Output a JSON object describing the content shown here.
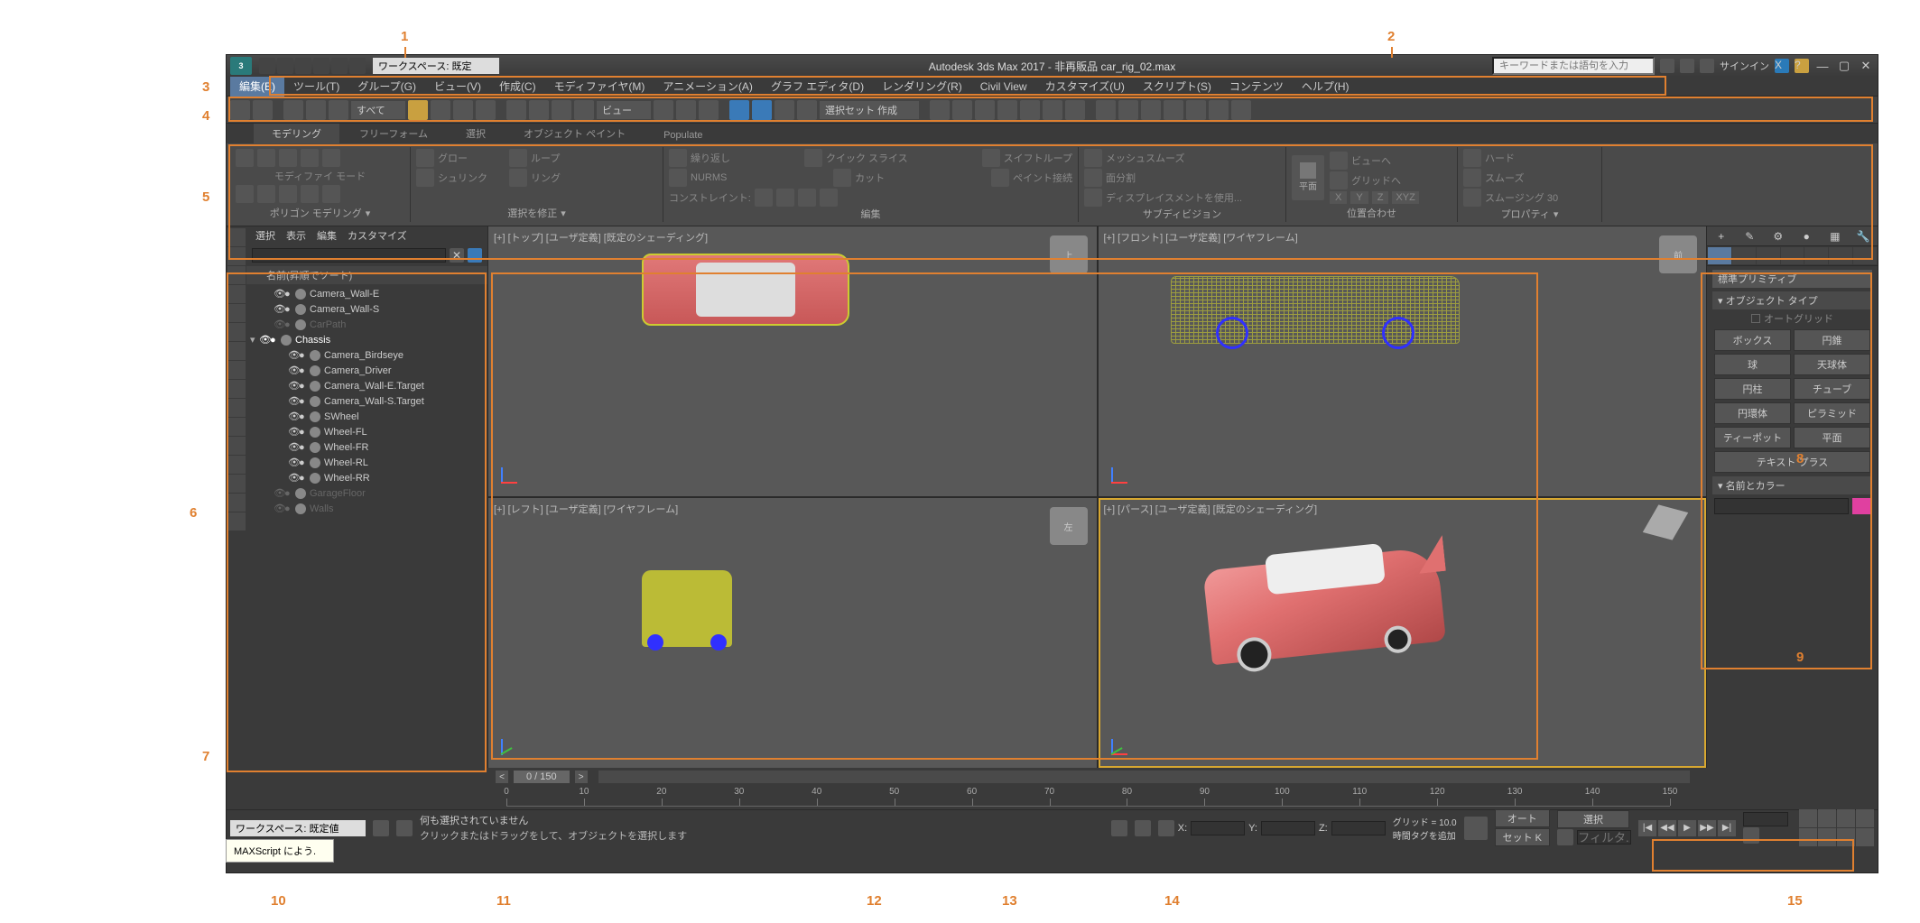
{
  "title": "Autodesk 3ds Max 2017  - 非再販品    car_rig_02.max",
  "workspace_combo": "ワークスペース: 既定",
  "search_placeholder": "キーワードまたは語句を入力",
  "signin": "サインイン",
  "menubar": [
    "編集(E)",
    "ツール(T)",
    "グループ(G)",
    "ビュー(V)",
    "作成(C)",
    "モディファイヤ(M)",
    "アニメーション(A)",
    "グラフ エディタ(D)",
    "レンダリング(R)",
    "Civil View",
    "カスタマイズ(U)",
    "スクリプト(S)",
    "コンテンツ",
    "ヘルプ(H)"
  ],
  "main_toolbar": {
    "dropdown1": "すべて",
    "dropdown_view": "ビュー",
    "sel_set": "選択セット 作成"
  },
  "ribbon_tabs": [
    "モデリング",
    "フリーフォーム",
    "選択",
    "オブジェクト ペイント",
    "Populate"
  ],
  "ribbon": {
    "mode_label": "モディファイ モード",
    "grow": "グロー",
    "shrink": "シュリンク",
    "loop": "ループ",
    "ring": "リング",
    "repeat": "繰り返し",
    "nurms": "NURMS",
    "quickslice": "クイック スライス",
    "cut": "カット",
    "swiftloop": "スイフトループ",
    "paintconnect": "ペイント接続",
    "constraint": "コンストレイント:",
    "meshsmooth": "メッシュスムーズ",
    "tessellate": "面分割",
    "disp": "ディスプレイスメントを使用...",
    "plane_label": "平面",
    "viewto": "ビューへ",
    "gridto": "グリッドへ",
    "hard": "ハード",
    "smooth": "スムーズ",
    "smoothing30": "スムージング 30",
    "xyz": "XYZ",
    "x": "X",
    "y": "Y",
    "z": "Z",
    "group_polymodel": "ポリゴン モデリング",
    "group_modsel": "選択を修正",
    "group_edit": "編集",
    "group_subdiv": "サブディビジョン",
    "group_align": "位置合わせ",
    "group_props": "プロパティ"
  },
  "scene_explorer": {
    "menus": [
      "選択",
      "表示",
      "編集",
      "カスタマイズ"
    ],
    "sort_header": "名前(昇順でソート)",
    "items": [
      {
        "name": "Camera_Wall-E",
        "indent": 1,
        "dim": false
      },
      {
        "name": "Camera_Wall-S",
        "indent": 1,
        "dim": false
      },
      {
        "name": "CarPath",
        "indent": 1,
        "dim": true
      },
      {
        "name": "Chassis",
        "indent": 0,
        "dim": false,
        "exp": true
      },
      {
        "name": "Camera_Birdseye",
        "indent": 2,
        "dim": false
      },
      {
        "name": "Camera_Driver",
        "indent": 2,
        "dim": false
      },
      {
        "name": "Camera_Wall-E.Target",
        "indent": 2,
        "dim": false
      },
      {
        "name": "Camera_Wall-S.Target",
        "indent": 2,
        "dim": false
      },
      {
        "name": "SWheel",
        "indent": 2,
        "dim": false
      },
      {
        "name": "Wheel-FL",
        "indent": 2,
        "dim": false
      },
      {
        "name": "Wheel-FR",
        "indent": 2,
        "dim": false
      },
      {
        "name": "Wheel-RL",
        "indent": 2,
        "dim": false
      },
      {
        "name": "Wheel-RR",
        "indent": 2,
        "dim": false
      },
      {
        "name": "GarageFloor",
        "indent": 1,
        "dim": true
      },
      {
        "name": "Walls",
        "indent": 1,
        "dim": true
      }
    ]
  },
  "viewports": {
    "top": "[+] [トップ] [ユーザ定義] [既定のシェーディング]",
    "front": "[+] [フロント] [ユーザ定義] [ワイヤフレーム]",
    "left": "[+] [レフト] [ユーザ定義] [ワイヤフレーム]",
    "persp": "[+] [パース] [ユーザ定義] [既定のシェーディング]",
    "cube_top": "上",
    "cube_front": "前",
    "cube_left": "左"
  },
  "cmd_panel": {
    "geom_combo": "標準プリミティブ",
    "rollout_objtype": "オブジェクト タイプ",
    "autogrid": "オートグリッド",
    "buttons": [
      "ボックス",
      "円錐",
      "球",
      "天球体",
      "円柱",
      "チューブ",
      "円環体",
      "ピラミッド",
      "ティーポット",
      "平面",
      "テキスト プラス"
    ],
    "rollout_namecolor": "名前とカラー"
  },
  "time_slider": "0 / 150",
  "track_ticks": [
    0,
    10,
    20,
    30,
    40,
    50,
    60,
    70,
    80,
    90,
    100,
    110,
    120,
    130,
    140,
    150
  ],
  "status": {
    "ws_combo": "ワークスペース: 既定値",
    "sel_info": "何も選択されていません",
    "prompt": "クリックまたはドラッグをして、オブジェクトを選択します",
    "x_label": "X:",
    "y_label": "Y:",
    "z_label": "Z:",
    "grid": "グリッド = 10.0",
    "timetag": "時間タグを追加",
    "autokey": "オート",
    "setkey": "セット K",
    "keyfilter_label": "選択",
    "filter_placeholder": "フィルタ..."
  },
  "maxscript_popup": "MAXScript によう.",
  "callouts": [
    "1",
    "2",
    "3",
    "4",
    "5",
    "6",
    "7",
    "8",
    "9",
    "10",
    "11",
    "12",
    "13",
    "14",
    "15"
  ]
}
